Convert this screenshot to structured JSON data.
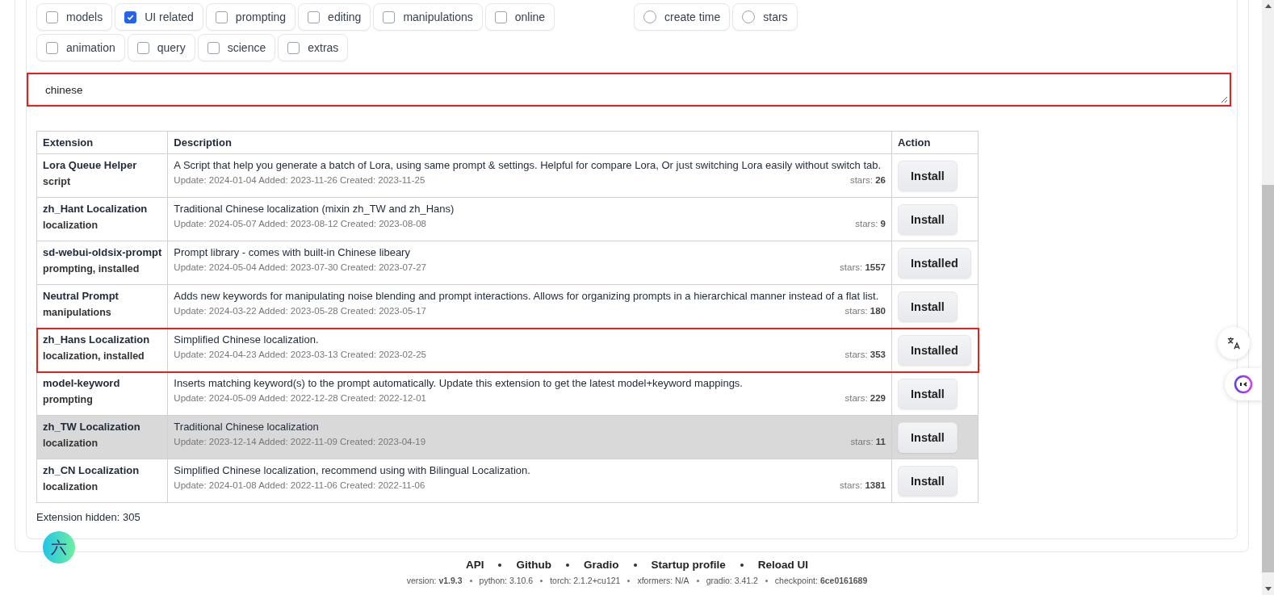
{
  "filters": [
    {
      "label": "models",
      "checked": false
    },
    {
      "label": "UI related",
      "checked": true
    },
    {
      "label": "prompting",
      "checked": false
    },
    {
      "label": "editing",
      "checked": false
    },
    {
      "label": "manipulations",
      "checked": false
    },
    {
      "label": "online",
      "checked": false
    },
    {
      "label": "animation",
      "checked": false
    },
    {
      "label": "query",
      "checked": false
    },
    {
      "label": "science",
      "checked": false
    },
    {
      "label": "extras",
      "checked": false
    }
  ],
  "sort_options": [
    {
      "label": "create time",
      "selected": false
    },
    {
      "label": "stars",
      "selected": false
    }
  ],
  "search": {
    "value": "chinese",
    "highlighted": true
  },
  "table": {
    "columns": [
      "Extension",
      "Description",
      "Action"
    ],
    "rows": [
      {
        "name": "Lora Queue Helper",
        "tags": "script",
        "description": "A Script that help you generate a batch of Lora, using same prompt & settings. Helpful for compare Lora, Or just switching Lora easily without switch tab.",
        "dates": "Update: 2024-01-04 Added: 2023-11-26 Created: 2023-11-25",
        "stars": "stars: **26**",
        "action": "Install",
        "highlighted": false,
        "hovered": false
      },
      {
        "name": "zh_Hant Localization",
        "tags": "localization",
        "description": "Traditional Chinese localization (mixin zh_TW and zh_Hans)",
        "dates": "Update: 2024-05-07 Added: 2023-08-12 Created: 2023-08-08",
        "stars": "stars: **9**",
        "action": "Install",
        "highlighted": false,
        "hovered": false
      },
      {
        "name": "sd-webui-oldsix-prompt",
        "tags": "prompting, installed",
        "description": "Prompt library - comes with built-in Chinese libeary",
        "dates": "Update: 2024-05-04 Added: 2023-07-30 Created: 2023-07-27",
        "stars": "stars: **1557**",
        "action": "Installed",
        "highlighted": false,
        "hovered": false
      },
      {
        "name": "Neutral Prompt",
        "tags": "manipulations",
        "description": "Adds new keywords for manipulating noise blending and prompt interactions. Allows for organizing prompts in a hierarchical manner instead of a flat list.",
        "dates": "Update: 2024-03-22 Added: 2023-05-28 Created: 2023-05-17",
        "stars": "stars: **180**",
        "action": "Install",
        "highlighted": false,
        "hovered": false
      },
      {
        "name": "zh_Hans Localization",
        "tags": "localization, installed",
        "description": "Simplified Chinese localization.",
        "dates": "Update: 2024-04-23 Added: 2023-03-13 Created: 2023-02-25",
        "stars": "stars: **353**",
        "action": "Installed",
        "highlighted": true,
        "hovered": false
      },
      {
        "name": "model-keyword",
        "tags": "prompting",
        "description": "Inserts matching keyword(s) to the prompt automatically. Update this extension to get the latest model+keyword mappings.",
        "dates": "Update: 2024-05-09 Added: 2022-12-28 Created: 2022-12-01",
        "stars": "stars: **229**",
        "action": "Install",
        "highlighted": false,
        "hovered": false
      },
      {
        "name": "zh_TW Localization",
        "tags": "localization",
        "description": "Traditional Chinese localization",
        "dates": "Update: 2023-12-14 Added: 2022-11-09 Created: 2023-04-19",
        "stars": "stars: **11**",
        "action": "Install",
        "highlighted": false,
        "hovered": true
      },
      {
        "name": "zh_CN Localization",
        "tags": "localization",
        "description": "Simplified Chinese localization, recommend using with Bilingual Localization.",
        "dates": "Update: 2024-01-08 Added: 2022-11-06 Created: 2022-11-06",
        "stars": "stars: **1381**",
        "action": "Install",
        "highlighted": false,
        "hovered": false
      }
    ]
  },
  "hidden_count": "Extension hidden: 305",
  "badge": "六",
  "footer": {
    "links": [
      "API",
      "Github",
      "Gradio",
      "Startup profile",
      "Reload UI"
    ],
    "info": [
      "version: **v1.9.3**",
      "python: 3.10.6",
      "torch: 2.1.2+cu121",
      "xformers: N/A",
      "gradio: 3.41.2",
      "checkpoint: **6ce0161689**"
    ]
  }
}
